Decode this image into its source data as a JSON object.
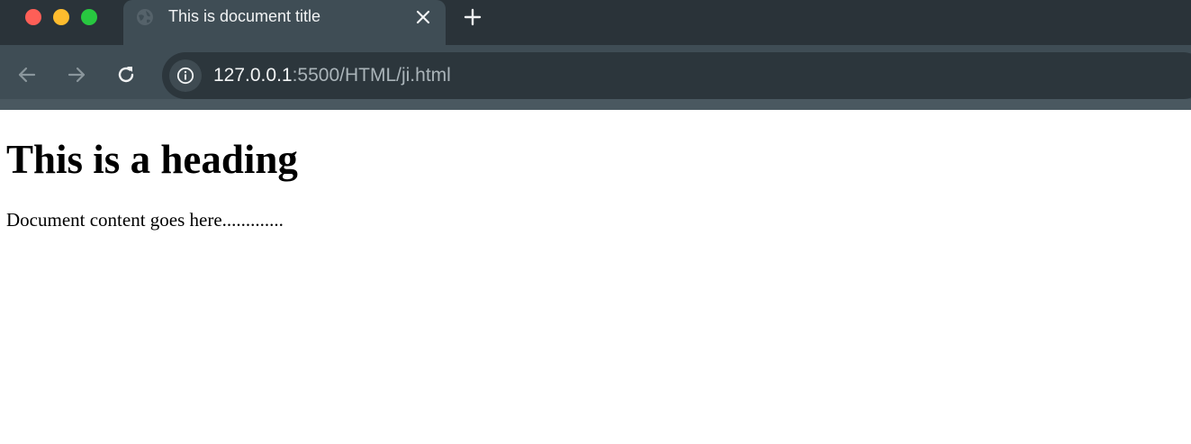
{
  "window": {
    "controls": [
      "close",
      "minimize",
      "zoom"
    ],
    "colors": {
      "close": "#fe5f57",
      "minimize": "#febc2e",
      "zoom": "#28c840"
    }
  },
  "tab": {
    "title": "This is document title",
    "favicon_icon": "globe-icon",
    "close_icon": "close-icon"
  },
  "new_tab_icon": "plus-icon",
  "toolbar": {
    "back_icon": "arrow-left-icon",
    "forward_icon": "arrow-right-icon",
    "reload_icon": "reload-icon",
    "site_info_icon": "info-icon"
  },
  "address_bar": {
    "host": "127.0.0.1",
    "path": ":5500/HTML/ji.html"
  },
  "page": {
    "heading": "This is a heading",
    "content": "Document content goes here............."
  }
}
